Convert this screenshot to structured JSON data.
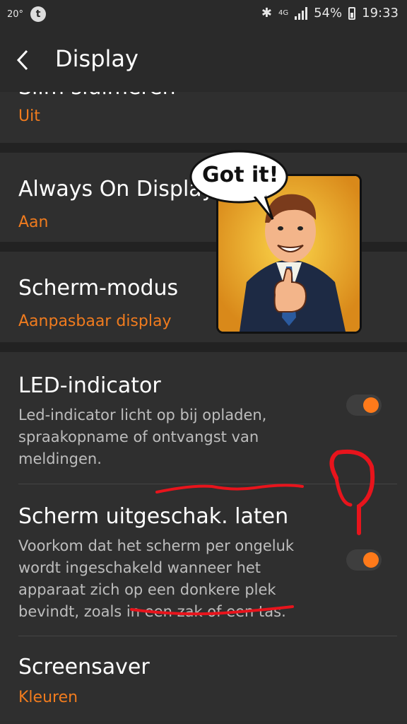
{
  "status_bar": {
    "temperature": "20°",
    "network": "4G",
    "battery": "54%",
    "time": "19:33"
  },
  "app_bar": {
    "title": "Display"
  },
  "settings": [
    {
      "title": "Slim sluimeren",
      "subtitle": "Uit"
    },
    {
      "title": "Always On Display",
      "subtitle": "Aan"
    },
    {
      "title": "Scherm-modus",
      "subtitle": "Aanpasbaar display"
    },
    {
      "title": "LED-indicator",
      "description": "Led-indicator licht op bij opladen, spraakopname of ontvangst van meldingen.",
      "toggle_on": true
    },
    {
      "title": "Scherm uitgeschak. laten",
      "description": "Voorkom dat het scherm per ongeluk wordt ingeschakeld wanneer het apparaat zich op een donkere plek bevindt, zoals in een zak of een tas.",
      "toggle_on": true
    },
    {
      "title": "Screensaver",
      "subtitle": "Kleuren"
    }
  ],
  "overlay": {
    "speech_bubble": "Got it!",
    "scribble": "?"
  },
  "colors": {
    "accent": "#f07b1e",
    "toggle_thumb": "#ff7a1a",
    "annotation": "#e8141c"
  }
}
